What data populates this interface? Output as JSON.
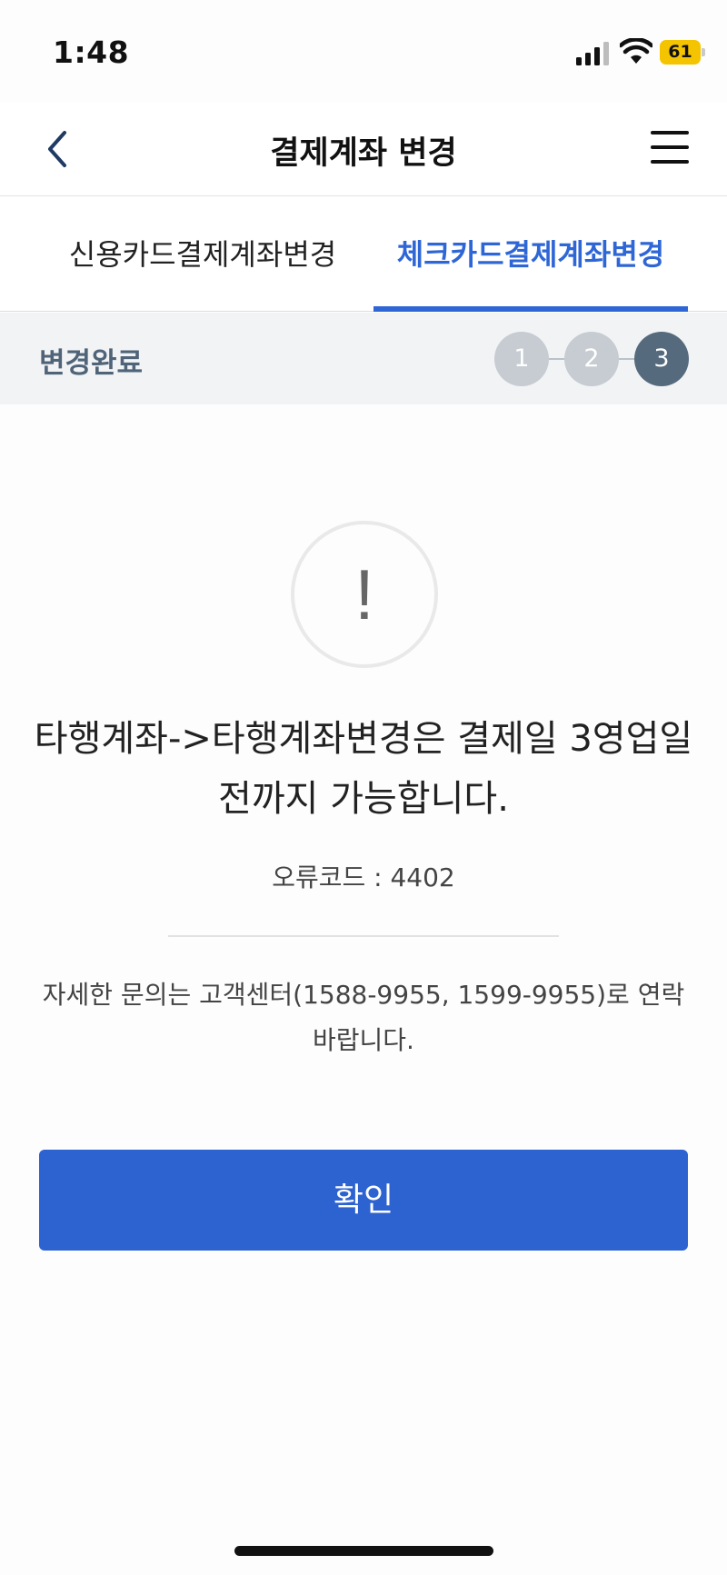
{
  "status_bar": {
    "time": "1:48",
    "battery_level": "61",
    "icons": [
      "signal-icon",
      "wifi-icon",
      "battery-icon"
    ],
    "battery_color": "#f5c400"
  },
  "header": {
    "title": "결제계좌 변경",
    "back_icon": "chevron-left-icon",
    "menu_icon": "hamburger-menu-icon"
  },
  "tabs": [
    {
      "label": "신용카드결제계좌변경",
      "active": false
    },
    {
      "label": "체크카드결제계좌변경",
      "active": true
    }
  ],
  "steps": {
    "label": "변경완료",
    "items": [
      "1",
      "2",
      "3"
    ],
    "current": 3
  },
  "content": {
    "alert_icon": "exclamation-icon",
    "alert_symbol": "!",
    "message": "타행계좌->타행계좌변경은 결제일 3영업일전까지 가능합니다.",
    "error_code": "오류코드 : 4402",
    "contact_text": "자세한 문의는 고객센터(1588-9955, 1599-9955)로 연락바랍니다."
  },
  "confirm_button": {
    "label": "확인"
  },
  "colors": {
    "accent": "#2f66d6",
    "button": "#2d63d0",
    "step_active": "#566a7e",
    "step_inactive": "#c6ccd2"
  }
}
